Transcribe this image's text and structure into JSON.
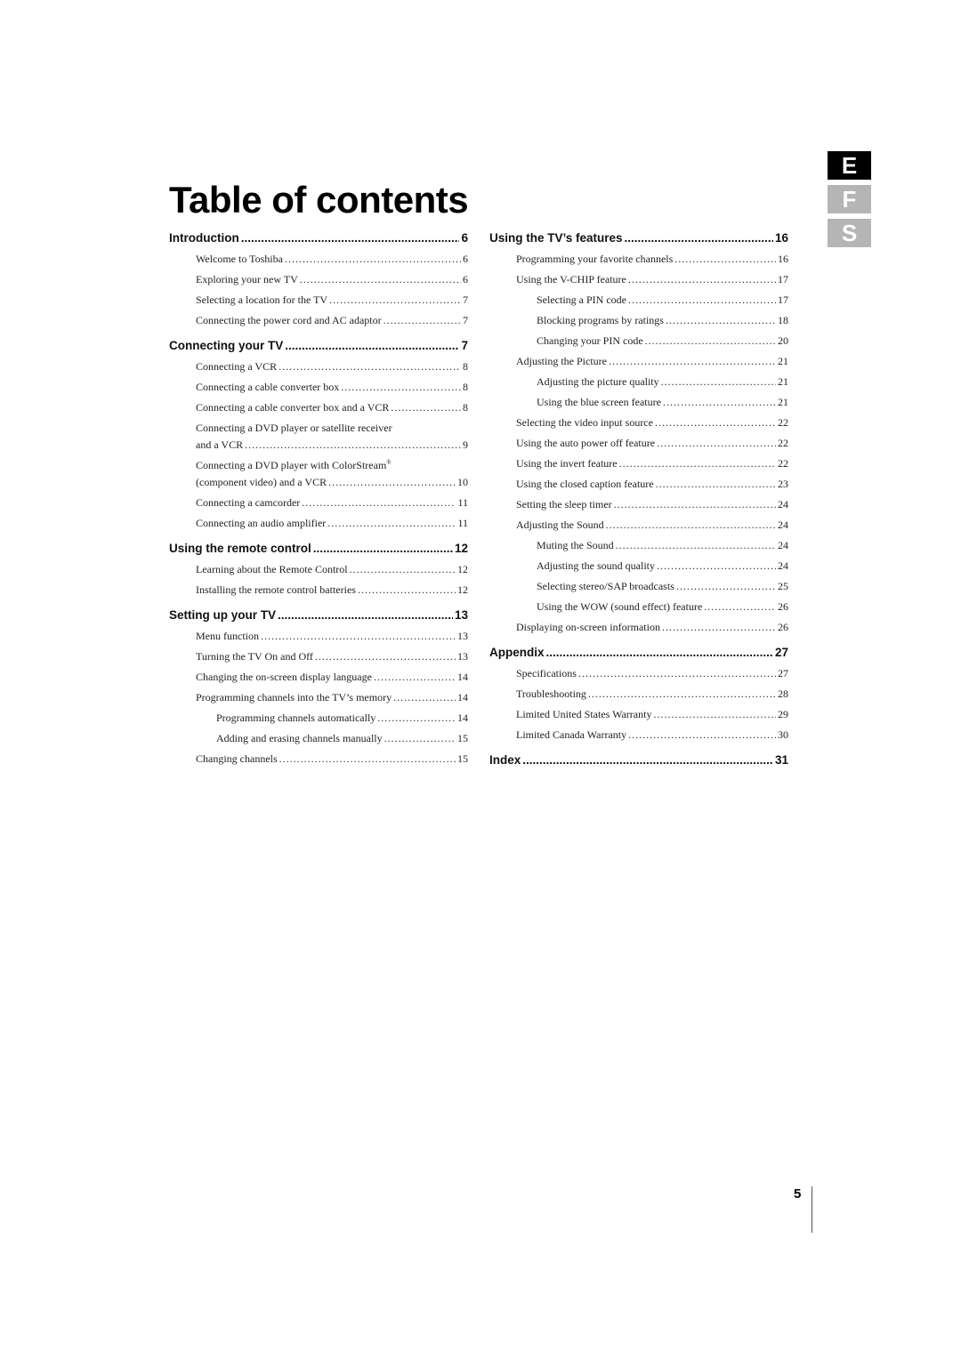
{
  "title": "Table of contents",
  "language_tabs": [
    {
      "label": "E",
      "active": true
    },
    {
      "label": "F",
      "active": false
    },
    {
      "label": "S",
      "active": false
    }
  ],
  "colors": {
    "active_tab": "#000000",
    "inactive_tab": "#b5b5b5"
  },
  "left_column": {
    "introduction": {
      "label": "Introduction",
      "page": "6",
      "items": [
        {
          "label": "Welcome to Toshiba",
          "page": "6"
        },
        {
          "label": "Exploring your new TV",
          "page": "6"
        },
        {
          "label": "Selecting a location for the TV",
          "page": "7"
        },
        {
          "label": "Connecting the power cord and AC adaptor",
          "page": "7"
        }
      ]
    },
    "connecting": {
      "label": "Connecting your TV",
      "page": "7",
      "items": [
        {
          "label": "Connecting a VCR",
          "page": "8"
        },
        {
          "label": "Connecting a cable converter box",
          "page": "8"
        },
        {
          "label": "Connecting a cable converter box and a VCR",
          "page": "8"
        },
        {
          "label_line1": "Connecting a DVD player or satellite receiver",
          "label": "and a VCR",
          "page": "9"
        },
        {
          "label_line1": "Connecting a DVD player with ColorStream",
          "reg": "®",
          "label": "(component video) and a VCR",
          "page": "10"
        },
        {
          "label": "Connecting a camcorder",
          "page": "11"
        },
        {
          "label": "Connecting an audio amplifier",
          "page": "11"
        }
      ]
    },
    "remote": {
      "label": "Using the remote control",
      "page": "12",
      "items": [
        {
          "label": "Learning about the Remote Control",
          "page": "12"
        },
        {
          "label": "Installing the remote control batteries",
          "page": "12"
        }
      ]
    },
    "setup": {
      "label": "Setting up your TV",
      "page": "13",
      "items": [
        {
          "label": "Menu function",
          "page": "13"
        },
        {
          "label": "Turning the TV On and Off",
          "page": "13"
        },
        {
          "label": "Changing the on-screen display language",
          "page": "14"
        },
        {
          "label": "Programming channels into the TV’s memory",
          "page": "14"
        },
        {
          "label": "Programming channels automatically",
          "page": "14"
        },
        {
          "label": "Adding and erasing channels manually",
          "page": "15"
        },
        {
          "label": "Changing channels",
          "page": "15"
        }
      ]
    }
  },
  "right_column": {
    "features": {
      "label": "Using the TV’s features",
      "page": "16",
      "items": [
        {
          "label": "Programming your favorite channels",
          "page": "16"
        },
        {
          "label": "Using the V-CHIP feature",
          "page": "17"
        },
        {
          "label": "Selecting a PIN code",
          "page": "17"
        },
        {
          "label": "Blocking programs by ratings",
          "page": "18"
        },
        {
          "label": "Changing your PIN code",
          "page": "20"
        },
        {
          "label": "Adjusting the Picture",
          "page": "21"
        },
        {
          "label": "Adjusting the picture quality",
          "page": "21"
        },
        {
          "label": "Using the blue screen feature",
          "page": "21"
        },
        {
          "label": "Selecting the video input source",
          "page": "22"
        },
        {
          "label": "Using the auto power off feature",
          "page": "22"
        },
        {
          "label": "Using the invert feature",
          "page": "22"
        },
        {
          "label": "Using the closed caption feature",
          "page": "23"
        },
        {
          "label": "Setting the sleep timer",
          "page": "24"
        },
        {
          "label": "Adjusting the Sound",
          "page": "24"
        },
        {
          "label": "Muting the Sound",
          "page": "24"
        },
        {
          "label": "Adjusting the sound quality",
          "page": "24"
        },
        {
          "label": "Selecting stereo/SAP broadcasts",
          "page": "25"
        },
        {
          "label": "Using the WOW (sound effect) feature",
          "page": "26"
        },
        {
          "label": "Displaying on-screen information",
          "page": "26"
        }
      ]
    },
    "appendix": {
      "label": "Appendix",
      "page": "27",
      "items": [
        {
          "label": "Specifications",
          "page": "27"
        },
        {
          "label": "Troubleshooting",
          "page": "28"
        },
        {
          "label": "Limited United States Warranty",
          "page": "29"
        },
        {
          "label": "Limited Canada Warranty",
          "page": "30"
        }
      ]
    },
    "index": {
      "label": "Index",
      "page": "31"
    }
  },
  "page_number": "5"
}
